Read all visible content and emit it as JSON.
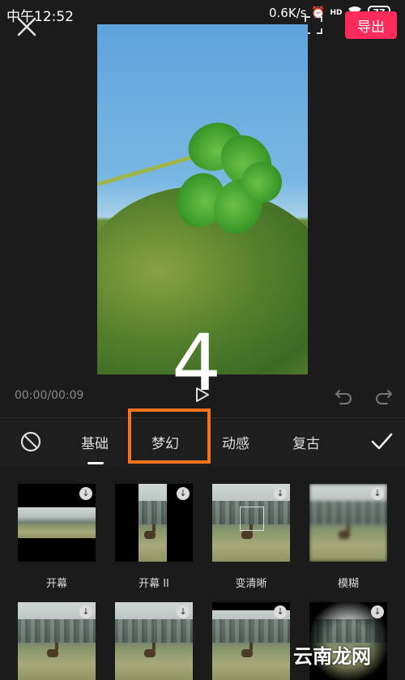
{
  "status_bar": {
    "time": "中午12:52",
    "speed": "0.6K/s",
    "network": "HD",
    "battery": "77"
  },
  "header": {
    "export_label": "导出"
  },
  "preview": {
    "countdown": "4"
  },
  "player": {
    "timecode": "00:00/00:09"
  },
  "tabs": [
    {
      "label": "基础"
    },
    {
      "label": "梦幻"
    },
    {
      "label": "动感"
    },
    {
      "label": "复古"
    }
  ],
  "selected_tab": "基础",
  "highlighted_tab": "梦幻",
  "effects": [
    {
      "label": "开幕"
    },
    {
      "label": "开幕 II"
    },
    {
      "label": "变清晰"
    },
    {
      "label": "模糊"
    }
  ],
  "watermark": "云南龙网",
  "colors": {
    "accent": "#ff2b5b",
    "highlight_box": "#f5731f",
    "background": "#1b1b1b"
  }
}
